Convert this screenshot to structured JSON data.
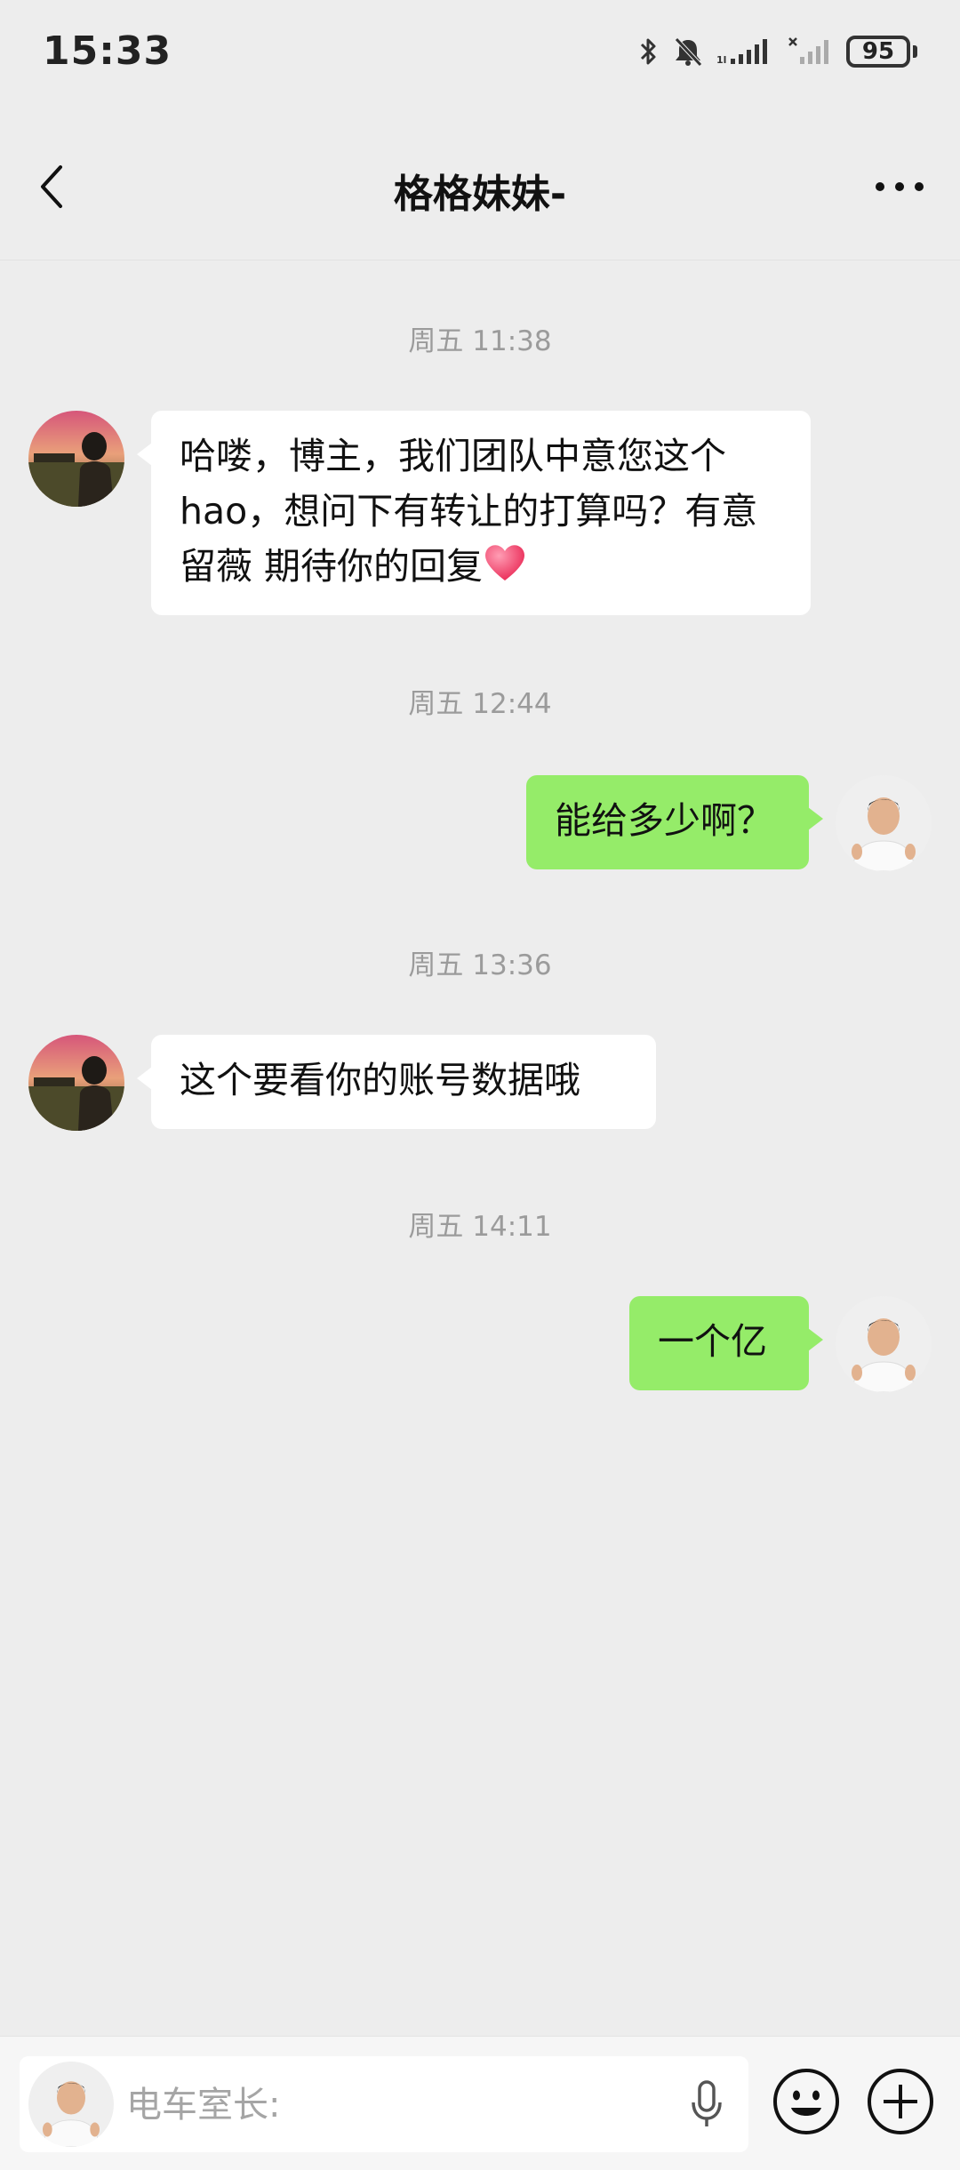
{
  "status_bar": {
    "time": "15:33",
    "battery": "95"
  },
  "header": {
    "title": "格格妹妹-"
  },
  "messages": [
    {
      "timestamp": "周五 11:38",
      "sender": "contact",
      "text": "哈喽，博主，我们团队中意您这个hao，想问下有转让的打算吗？有意留薇 期待你的回复"
    },
    {
      "timestamp": "周五 12:44",
      "sender": "me",
      "text": "能给多少啊？"
    },
    {
      "timestamp": "周五 13:36",
      "sender": "contact",
      "text": "这个要看你的账号数据哦"
    },
    {
      "timestamp": "周五 14:11",
      "sender": "me",
      "text": "一个亿"
    }
  ],
  "input": {
    "placeholder": "电车室长:"
  },
  "icons": {
    "status": [
      "bluetooth-icon",
      "bell-muted-icon",
      "signal-icon",
      "signal-no-service-icon",
      "battery-icon"
    ],
    "message_emoji": "heart-emoji",
    "toolbar": [
      "voice-icon",
      "emoji-icon",
      "plus-icon"
    ]
  },
  "colors": {
    "background": "#ededed",
    "incoming_bubble": "#ffffff",
    "outgoing_bubble": "#95ec69",
    "timestamp": "#9b9b9b"
  }
}
